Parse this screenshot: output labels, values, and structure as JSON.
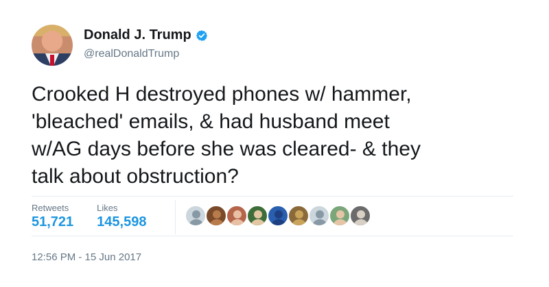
{
  "author": {
    "name": "Donald J. Trump",
    "handle": "@realDonaldTrump",
    "verified": true,
    "avatar_icon": "profile-photo"
  },
  "tweet": {
    "text": "Crooked H destroyed phones w/ hammer,\n'bleached' emails, & had husband meet\nw/AG days before she was cleared- & they\ntalk about obstruction?"
  },
  "stats": {
    "retweets_label": "Retweets",
    "retweets_value": "51,721",
    "likes_label": "Likes",
    "likes_value": "145,598"
  },
  "likers": [
    {
      "icon": "default-avatar-icon",
      "bg": "#ccd6dd",
      "fg": "#8899a6"
    },
    {
      "icon": "user-avatar-icon",
      "bg": "#7a4a2a",
      "fg": "#b87b4a"
    },
    {
      "icon": "user-avatar-icon",
      "bg": "#b5654a",
      "fg": "#e8c0a4"
    },
    {
      "icon": "user-avatar-icon",
      "bg": "#3d6e3a",
      "fg": "#e3c6a2"
    },
    {
      "icon": "user-avatar-icon",
      "bg": "#2a5fb0",
      "fg": "#1e3f80"
    },
    {
      "icon": "user-avatar-icon",
      "bg": "#8a6a3a",
      "fg": "#c9a45a"
    },
    {
      "icon": "default-avatar-icon",
      "bg": "#ccd6dd",
      "fg": "#8899a6"
    },
    {
      "icon": "user-avatar-icon",
      "bg": "#7aa67a",
      "fg": "#e6c4a6"
    },
    {
      "icon": "user-avatar-icon",
      "bg": "#6b6b6b",
      "fg": "#d8d0c4"
    }
  ],
  "timestamp": "12:56 PM - 15 Jun 2017",
  "colors": {
    "accent": "#1b95e0",
    "verified_badge": "#1da1f2",
    "muted_text": "#657786"
  }
}
